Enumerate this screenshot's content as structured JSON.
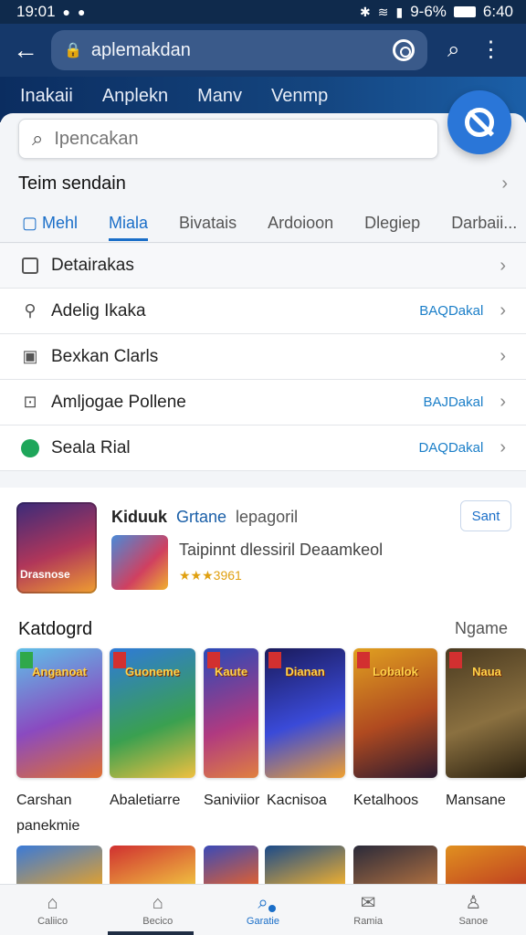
{
  "status_bar": {
    "time": "19:01",
    "battery": "9-6%",
    "clock": "6:40"
  },
  "url_bar": {
    "url": "aplemakdan"
  },
  "hero_nav": {
    "items": [
      "Inakaii",
      "Anplekn",
      "Manv",
      "Venmp"
    ]
  },
  "search": {
    "placeholder": "Ipencakan"
  },
  "section": {
    "title": "Teim sendain"
  },
  "tabs": [
    "Mehl",
    "Miala",
    "Bivatais",
    "Ardoioon",
    "Dlegiep",
    "Darbaii..."
  ],
  "list": [
    {
      "label": "Detairakas",
      "tag": ""
    },
    {
      "label": "Adelig Ikaka",
      "tag": "BAQDakal"
    },
    {
      "label": "Bexkan Clarls",
      "tag": ""
    },
    {
      "label": "Amljogae Pollene",
      "tag": "BAJDakal"
    },
    {
      "label": "Seala Rial",
      "tag": "DAQDakal"
    }
  ],
  "featured": {
    "brand": "Kiduuk",
    "title_highlight": "Grtane",
    "title_rest": "lepagoril",
    "description": "Taipinnt dlessiril Deaamkeol",
    "rating": "★★★3961",
    "image_label": "Drasnose",
    "button": "Sant"
  },
  "category": {
    "title": "Katdogrd",
    "more": "Ngame",
    "cards": [
      {
        "title": "Anganoat",
        "name": "Carshan",
        "name2": "panekmie"
      },
      {
        "title": "Guoneme",
        "name": "Abaletiarre",
        "name2": ""
      },
      {
        "title": "Kaute",
        "name": "Saniviior",
        "name2": ""
      },
      {
        "title": "Dianan",
        "name": "Kacnisoa",
        "name2": ""
      },
      {
        "title": "Lobalok",
        "name": "Ketalhoos",
        "name2": ""
      },
      {
        "title": "Naua",
        "name": "Mansane",
        "name2": ""
      }
    ]
  },
  "bottom_nav": [
    {
      "label": "Caliico",
      "icon": "home-icon"
    },
    {
      "label": "Becico",
      "icon": "store-icon"
    },
    {
      "label": "Garatie",
      "icon": "search-icon"
    },
    {
      "label": "Ramia",
      "icon": "mail-icon"
    },
    {
      "label": "Sanoe",
      "icon": "person-icon"
    }
  ],
  "colors": {
    "accent": "#1a6ec8",
    "header": "#15386a",
    "status": "#0f2a4c",
    "tag": "#1a7ec8"
  }
}
